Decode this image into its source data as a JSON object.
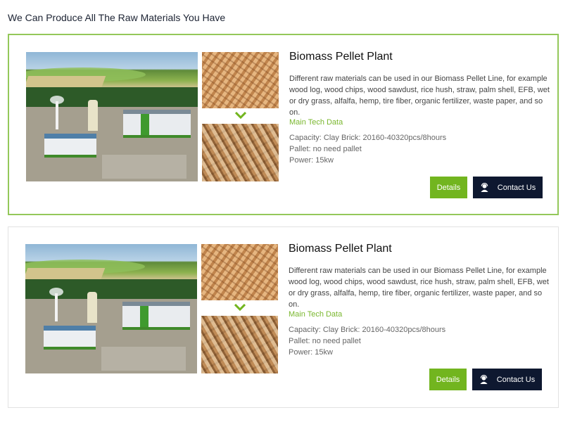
{
  "section": {
    "heading": "We Can Produce All The Raw Materials You Have"
  },
  "colors": {
    "accent_green": "#72b51f",
    "border_green": "#94c85a",
    "button_dark": "#0e1830"
  },
  "products": [
    {
      "title": "Biomass Pellet Plant",
      "description": "Different raw materials can be used in our Biomass Pellet Line, for example wood log, wood chips, wood sawdust, rice hush, straw, palm shell, EFB, wet or dry grass, alfalfa, hemp, tire fiber, organic fertilizer, waste paper, and so on.",
      "tech_label": "Main Tech Data",
      "specs": [
        "Capacity: Clay Brick: 20160-40320pcs/8hours",
        "Pallet: no need pallet",
        "Power: 15kw"
      ],
      "details_label": "Details",
      "contact_label": "Contact Us",
      "icons": {
        "arrow": "chevron-down-icon",
        "contact": "customer-service-icon"
      }
    },
    {
      "title": "Biomass Pellet Plant",
      "description": "Different raw materials can be used in our Biomass Pellet Line, for example wood log, wood chips, wood sawdust, rice hush, straw, palm shell, EFB, wet or dry grass, alfalfa, hemp, tire fiber, organic fertilizer, waste paper, and so on.",
      "tech_label": "Main Tech Data",
      "specs": [
        "Capacity: Clay Brick: 20160-40320pcs/8hours",
        "Pallet: no need pallet",
        "Power: 15kw"
      ],
      "details_label": "Details",
      "contact_label": "Contact Us",
      "icons": {
        "arrow": "chevron-down-icon",
        "contact": "customer-service-icon"
      }
    }
  ]
}
